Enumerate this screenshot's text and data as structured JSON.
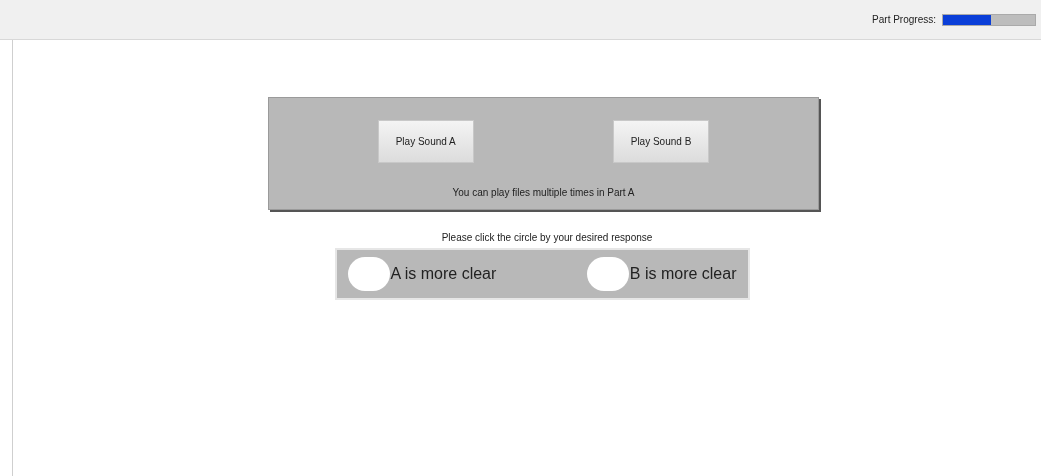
{
  "progress": {
    "label": "Part Progress:",
    "level": 0.52
  },
  "sound_panel": {
    "buttons": [
      {
        "label": "Play Sound A"
      },
      {
        "label": "Play Sound B"
      }
    ],
    "note": "You can play files multiple times in Part A"
  },
  "prompt": "Please click the circle by your desired response",
  "responses": [
    {
      "label": "A is more clear",
      "selected": false
    },
    {
      "label": "B is more clear",
      "selected": false
    }
  ]
}
